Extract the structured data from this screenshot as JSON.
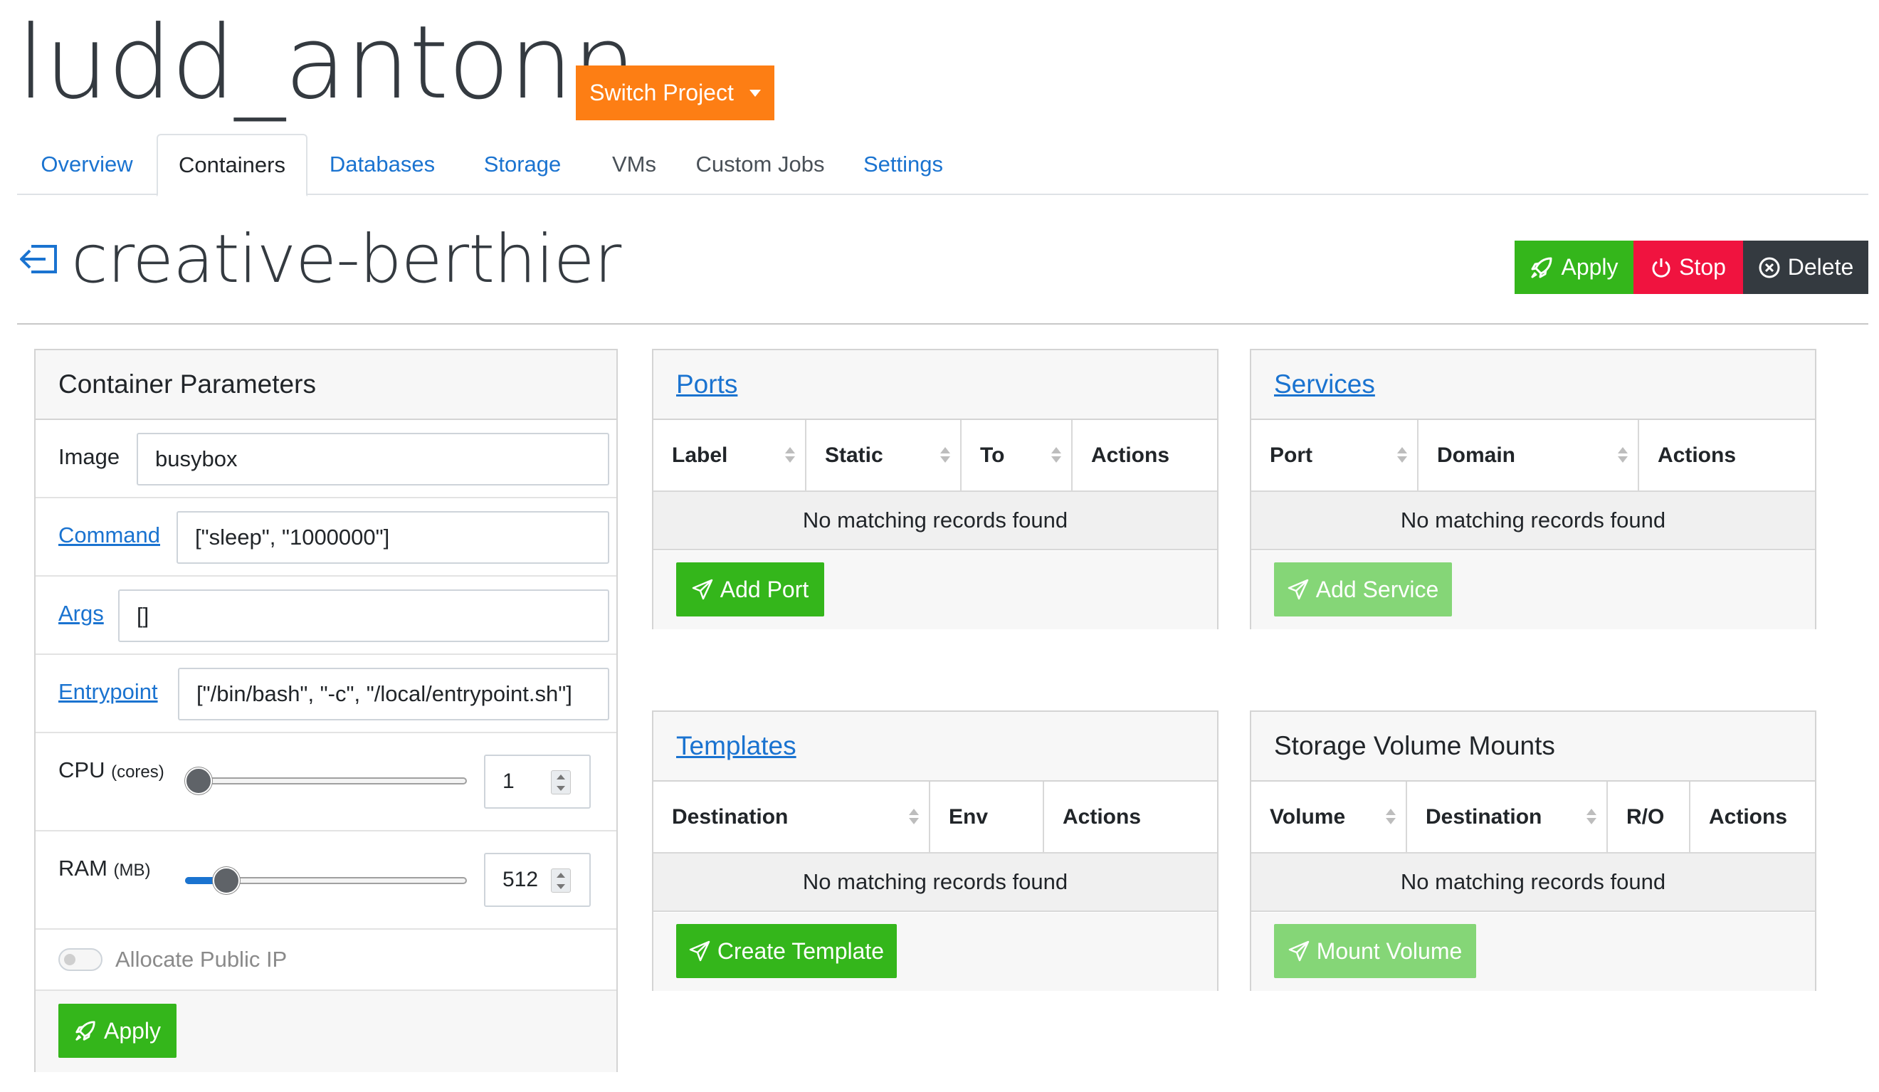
{
  "project": {
    "title": "ludd_antonn",
    "switch_label": "Switch Project"
  },
  "tabs": [
    {
      "label": "Overview"
    },
    {
      "label": "Containers"
    },
    {
      "label": "Databases"
    },
    {
      "label": "Storage"
    },
    {
      "label": "VMs"
    },
    {
      "label": "Custom Jobs"
    },
    {
      "label": "Settings"
    }
  ],
  "container": {
    "name": "creative-berthier",
    "actions": {
      "apply": "Apply",
      "stop": "Stop",
      "delete": "Delete"
    }
  },
  "params": {
    "header": "Container Parameters",
    "image_label": "Image",
    "image_value": "busybox",
    "command_label": "Command",
    "command_value": "[\"sleep\", \"1000000\"]",
    "args_label": "Args",
    "args_value": "[]",
    "entrypoint_label": "Entrypoint",
    "entrypoint_value": "[\"/bin/bash\", \"-c\", \"/local/entrypoint.sh\"]",
    "cpu_label": "CPU",
    "cpu_unit": "(cores)",
    "cpu_value": "1",
    "cpu_slider_fraction": 0.0,
    "ram_label": "RAM",
    "ram_unit": "(MB)",
    "ram_value": "512",
    "ram_slider_fraction": 0.06,
    "public_ip_label": "Allocate Public IP",
    "apply_label": "Apply"
  },
  "ports": {
    "header": "Ports",
    "columns": [
      "Label",
      "Static",
      "To",
      "Actions"
    ],
    "empty": "No matching records found",
    "button": "Add Port"
  },
  "services": {
    "header": "Services",
    "columns": [
      "Port",
      "Domain",
      "Actions"
    ],
    "empty": "No matching records found",
    "button": "Add Service"
  },
  "templates": {
    "header": "Templates",
    "columns": [
      "Destination",
      "Env",
      "Actions"
    ],
    "empty": "No matching records found",
    "button": "Create Template"
  },
  "volumes": {
    "header": "Storage Volume Mounts",
    "columns": [
      "Volume",
      "Destination",
      "R/O",
      "Actions"
    ],
    "empty": "No matching records found",
    "button": "Mount Volume"
  },
  "colors": {
    "orange": "#fd7e14",
    "green": "#34b61b",
    "red": "#f0133f",
    "dark": "#343a40",
    "link": "#1a73d0"
  }
}
